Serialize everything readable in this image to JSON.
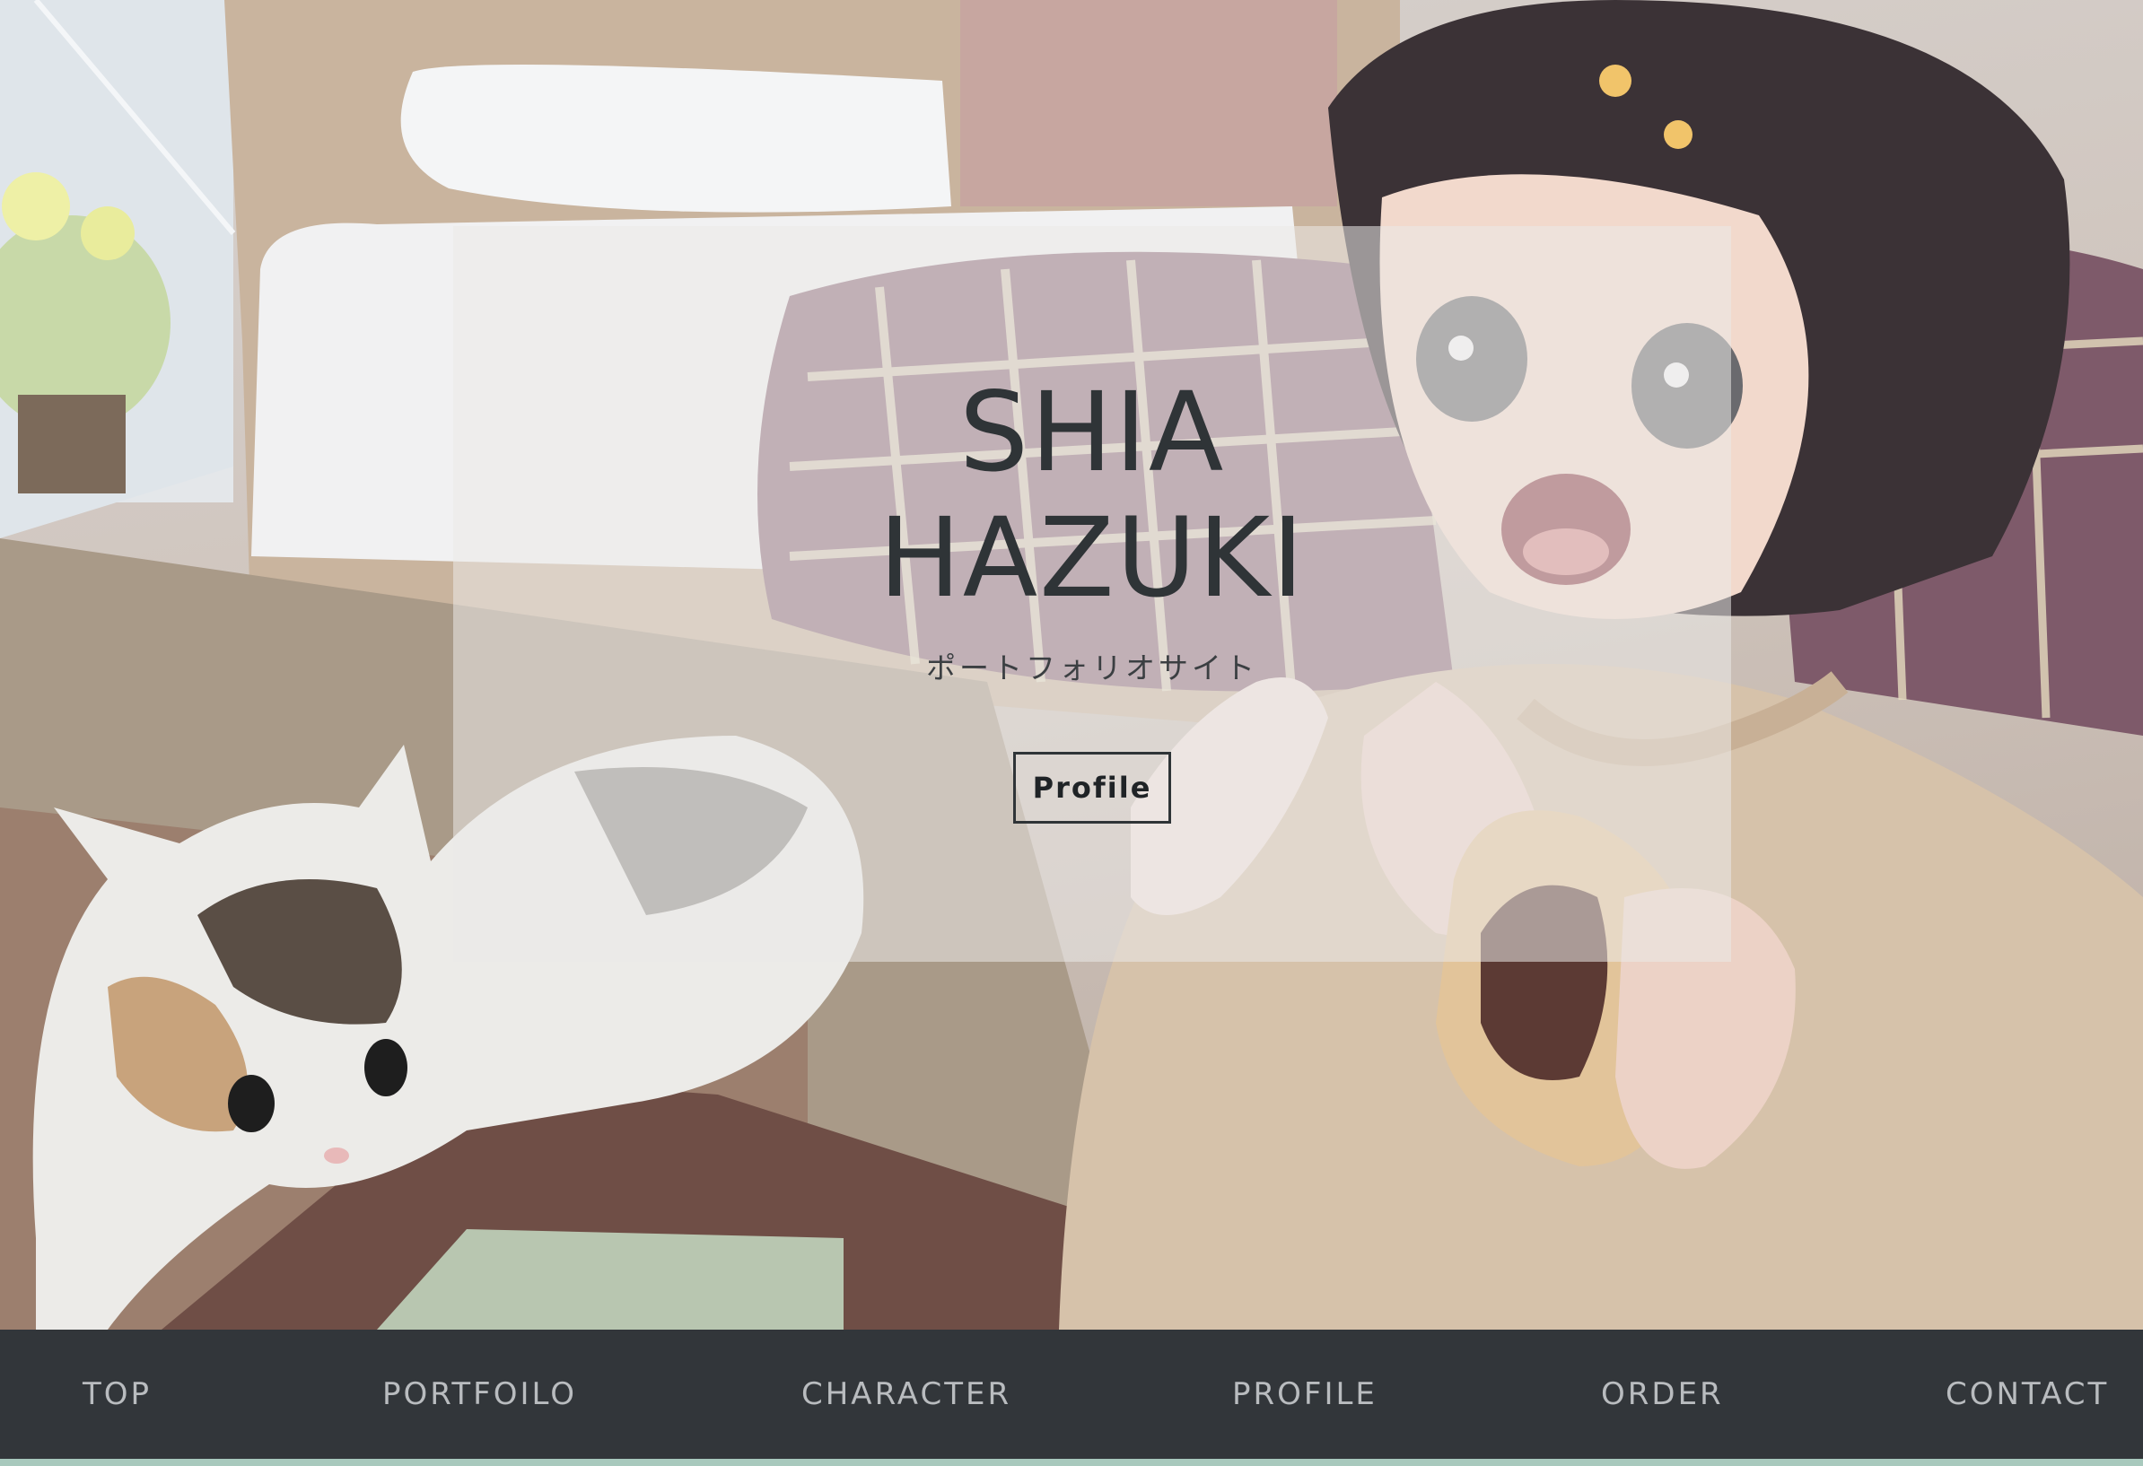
{
  "hero": {
    "title_line1": "SHIA",
    "title_line2": "HAZUKI",
    "subtitle": "ポートフォリオサイト",
    "profile_button_label": "Profile",
    "illustration": "illustration of a girl eating a bun with a calico cat in a room"
  },
  "nav": {
    "items": [
      {
        "label": "TOP"
      },
      {
        "label": "PORTFOILO"
      },
      {
        "label": "CHARACTER"
      },
      {
        "label": "PROFILE"
      },
      {
        "label": "ORDER"
      },
      {
        "label": "CONTACT"
      }
    ]
  },
  "colors": {
    "title_text": "#2f3437",
    "nav_background": "#32363a",
    "nav_text": "#b9bcbf",
    "nav_accent_line": "#a8c9bd",
    "card_overlay": "rgba(235,233,232,0.55)"
  }
}
